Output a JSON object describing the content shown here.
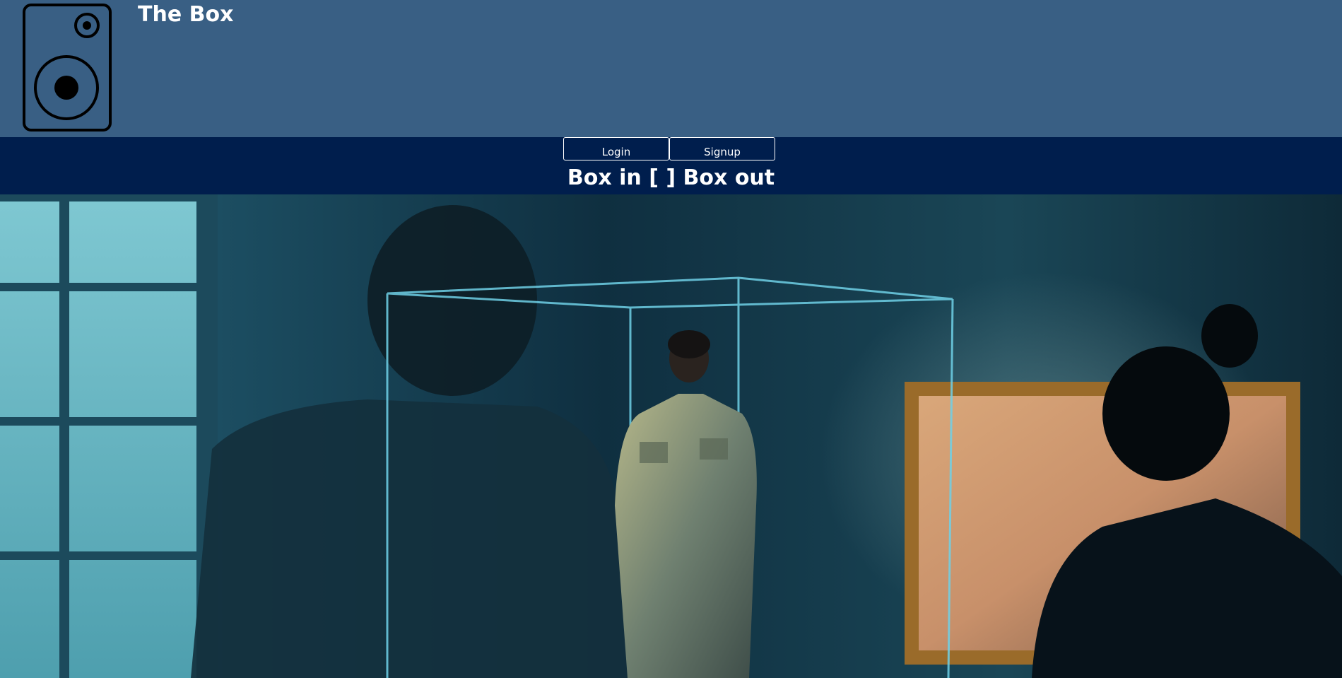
{
  "header": {
    "title": "The Box",
    "logo_icon": "speaker-icon",
    "background": "#395f84"
  },
  "navbar": {
    "login_label": "Login",
    "signup_label": "Signup",
    "tagline": "Box in [ ] Box out",
    "background": "#001e4d"
  },
  "hero": {
    "image": "museum-glass-box-scene"
  }
}
